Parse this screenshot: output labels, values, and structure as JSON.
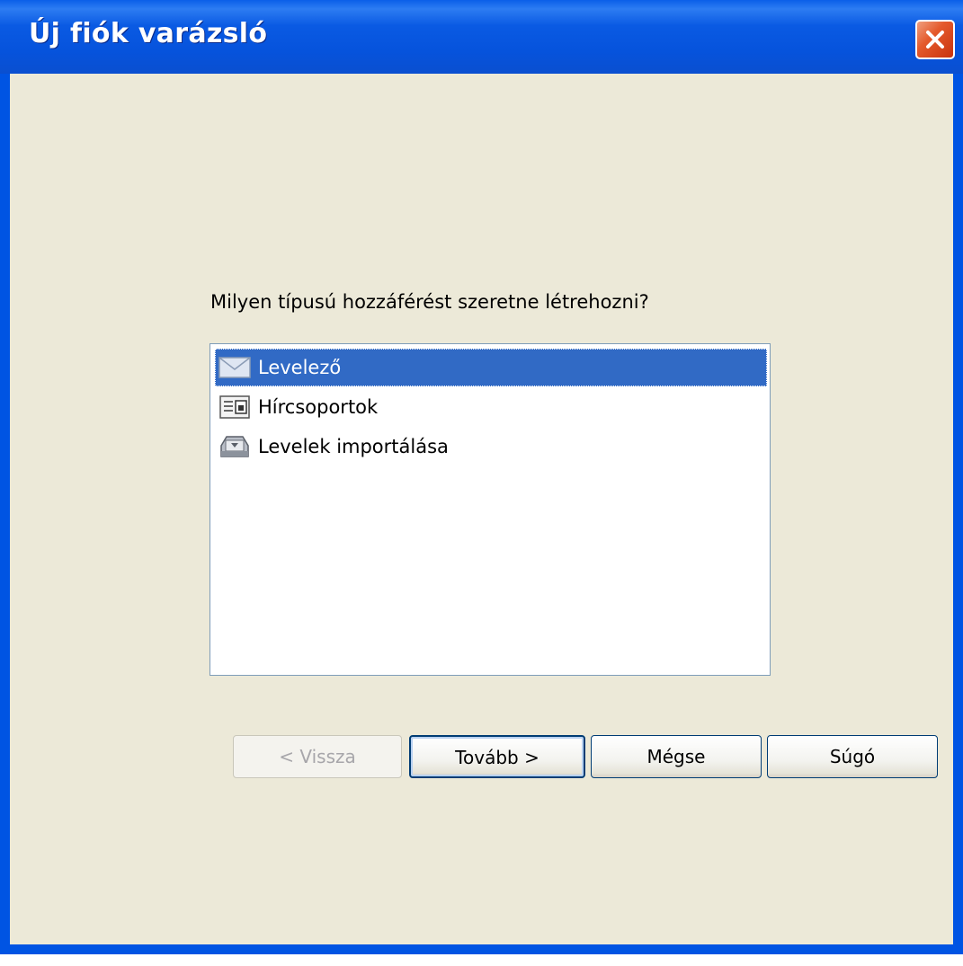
{
  "window": {
    "title": "Új fiók varázsló"
  },
  "wizard": {
    "prompt": "Milyen típusú hozzáférést szeretne létrehozni?",
    "account_types": [
      {
        "label": "Levelező",
        "icon": "mail-envelope-icon",
        "selected": true
      },
      {
        "label": "Hírcsoportok",
        "icon": "newsgroup-icon",
        "selected": false
      },
      {
        "label": "Levelek importálása",
        "icon": "import-tray-icon",
        "selected": false
      }
    ]
  },
  "buttons": {
    "back": "< Vissza",
    "next": "Tovább >",
    "cancel": "Mégse",
    "help": "Súgó"
  },
  "colors": {
    "titlebar": "#0054e3",
    "client_bg": "#ece9d8",
    "selection": "#316ac5",
    "close_button": "#e45a2c"
  }
}
